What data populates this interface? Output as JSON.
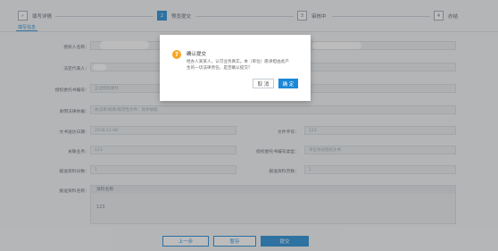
{
  "steps": [
    {
      "label": "填写详情",
      "icon": "check-icon"
    },
    {
      "label": "预览提交",
      "num": "2"
    },
    {
      "label": "审核中",
      "num": "3"
    },
    {
      "label": "办结",
      "num": "4"
    }
  ],
  "subtab": "填写信息",
  "form": {
    "f1_label": "授权人名称：",
    "f2_label": "法定代表人：",
    "f3_label": "授权委托书编号：",
    "f3_placeholder": "正式授权委托",
    "f4_label": "发明法律依据：",
    "f4_placeholder": "依法律/规章/规范性文件：具体依据",
    "f5_label": "文书送达日期：",
    "f5_value": "2018-11-08",
    "f6_label": "文件字号：",
    "f6_value": "123",
    "f7_label": "关联业务：",
    "f7_value": "123",
    "f8_label": "授权委托书编号类型：",
    "f8_placeholder": "单位有权授权文书",
    "f9_label": "报送资料份数：",
    "f9_value": "1",
    "f10_label": "报送资料页数：",
    "f10_value": "1",
    "f11_label": "报送资料名称：",
    "f11_head": "资料名称",
    "f11_value": "123"
  },
  "buttons": {
    "prev": "上一步",
    "save": "暂存",
    "submit": "提交"
  },
  "modal": {
    "icon": "warning-icon",
    "title": "确认提交",
    "message": "经办人某某人，认可业务真实。本（单位）愿承担由此产生的一切法律责任。是否确认提交？",
    "cancel": "取 消",
    "ok": "确 定"
  },
  "colors": {
    "accent": "#1a88d6",
    "warn": "#f5a623"
  }
}
